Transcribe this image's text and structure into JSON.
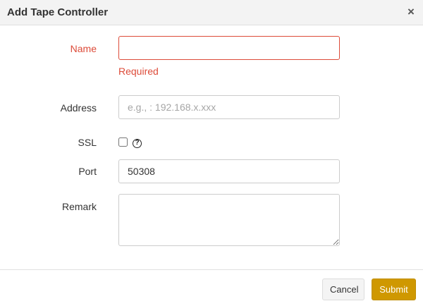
{
  "dialog": {
    "title": "Add Tape Controller",
    "close_glyph": "×"
  },
  "form": {
    "name": {
      "label": "Name",
      "value": "",
      "error": "Required"
    },
    "address": {
      "label": "Address",
      "value": "",
      "placeholder": "e.g., : 192.168.x.xxx"
    },
    "ssl": {
      "label": "SSL",
      "checked": false,
      "help_glyph": "?"
    },
    "port": {
      "label": "Port",
      "value": "50308"
    },
    "remark": {
      "label": "Remark",
      "value": ""
    }
  },
  "footer": {
    "cancel_label": "Cancel",
    "submit_label": "Submit"
  },
  "colors": {
    "error": "#dd4b39",
    "submit": "#cf9800",
    "header_bg": "#f3f3f3"
  },
  "icons": {
    "close": "close-icon",
    "help": "help-circle-icon"
  }
}
